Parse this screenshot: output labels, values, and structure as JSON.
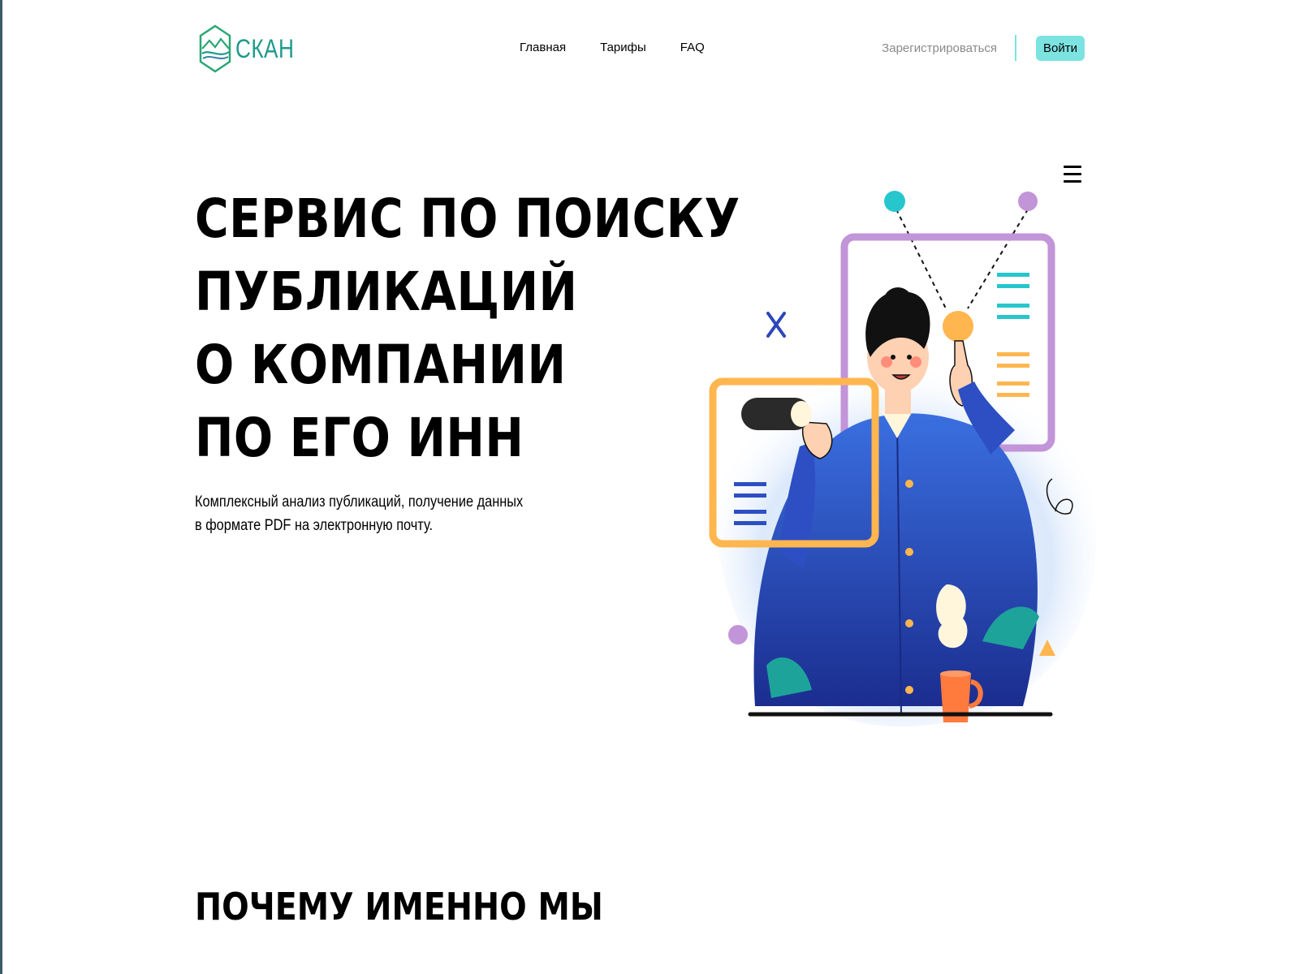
{
  "header": {
    "logo_text": "СКАН",
    "nav": [
      "Главная",
      "Тарифы",
      "FAQ"
    ],
    "register": "Зарегистрироваться",
    "login": "Войти"
  },
  "hero": {
    "title_lines": [
      "СЕРВИС ПО ПОИСКУ",
      "ПУБЛИКАЦИЙ",
      "О КОМПАНИИ",
      "ПО ЕГО ИНН"
    ],
    "description_lines": [
      "Комплексный анализ публикаций, получение данных",
      "в формате PDF на электронную почту."
    ]
  },
  "why_us": {
    "title": "ПОЧЕМУ ИМЕННО МЫ"
  },
  "colors": {
    "accent": "#7ce3e1",
    "brand": "#1f9a8c",
    "purple": "#c294d8",
    "orange": "#ffb64f",
    "blue": "#2d4fc3"
  }
}
